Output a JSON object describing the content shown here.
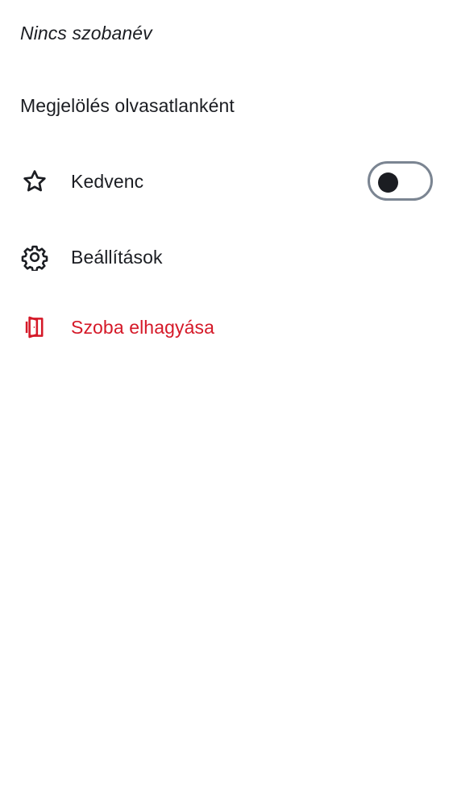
{
  "room": {
    "title": "Nincs szobanév"
  },
  "menu": {
    "mark_unread_label": "Megjelölés olvasatlanként",
    "favourite": {
      "label": "Kedvenc",
      "icon": "star-icon",
      "toggle_on": false
    },
    "settings": {
      "label": "Beállítások",
      "icon": "gear-icon"
    },
    "leave": {
      "label": "Szoba elhagyása",
      "icon": "leave-door-icon"
    }
  },
  "colors": {
    "text": "#1b1d22",
    "danger": "#d51928",
    "toggle_border": "#7b8592"
  }
}
